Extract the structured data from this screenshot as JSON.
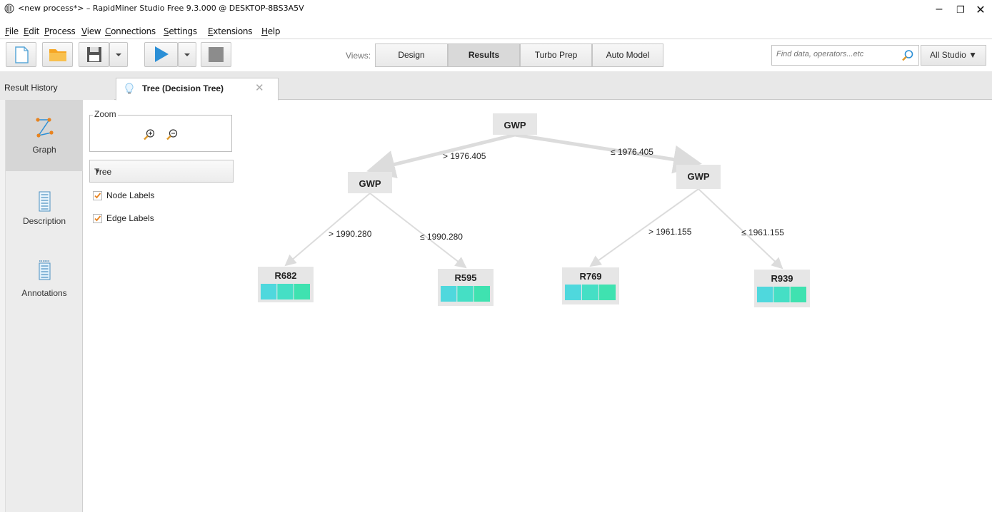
{
  "window": {
    "title": "<new process*> – RapidMiner Studio Free 9.3.000 @ DESKTOP-8BS3A5V",
    "controls": [
      "–",
      "❐",
      "✕"
    ]
  },
  "menu": [
    "File",
    "Edit",
    "Process",
    "View",
    "Connections",
    "Settings",
    "Extensions",
    "Help"
  ],
  "toolbar": {
    "views_label": "Views:",
    "views": [
      "Design",
      "Results",
      "Turbo Prep",
      "Auto Model"
    ],
    "active_view": "Results",
    "search_placeholder": "Find data, operators...etc",
    "studio_label": "All Studio ▼"
  },
  "tabs": {
    "history": "Result History",
    "active": "Tree (Decision Tree)",
    "close": "✕"
  },
  "sidebar": [
    {
      "label": "Graph",
      "icon": "graph-icon",
      "active": true
    },
    {
      "label": "Description",
      "icon": "description-icon",
      "active": false
    },
    {
      "label": "Annotations",
      "icon": "annotations-icon",
      "active": false
    }
  ],
  "options": {
    "zoom_label": "Zoom",
    "layout_value": "Tree",
    "node_labels": "Node Labels",
    "edge_labels": "Edge Labels",
    "node_labels_checked": true,
    "edge_labels_checked": true
  },
  "tree": {
    "nodes": [
      {
        "id": "root",
        "label": "GWP"
      },
      {
        "id": "left",
        "label": "GWP"
      },
      {
        "id": "right",
        "label": "GWP"
      },
      {
        "id": "l1",
        "label": "R682"
      },
      {
        "id": "l2",
        "label": "R595"
      },
      {
        "id": "l3",
        "label": "R769"
      },
      {
        "id": "l4",
        "label": "R939"
      }
    ],
    "edges": [
      {
        "from": "root",
        "to": "left",
        "label": "> 1976.405"
      },
      {
        "from": "root",
        "to": "right",
        "label": "≤ 1976.405"
      },
      {
        "from": "left",
        "to": "l1",
        "label": "> 1990.280"
      },
      {
        "from": "left",
        "to": "l2",
        "label": "≤ 1990.280"
      },
      {
        "from": "right",
        "to": "l3",
        "label": "> 1961.155"
      },
      {
        "from": "right",
        "to": "l4",
        "label": "≤ 1961.155"
      }
    ],
    "leaf_colors": [
      "#4fd8dd",
      "#45dfc5",
      "#3fe2b0"
    ],
    "node_fill": "#e6e6e6",
    "edge_color": "#dcdcdc"
  }
}
